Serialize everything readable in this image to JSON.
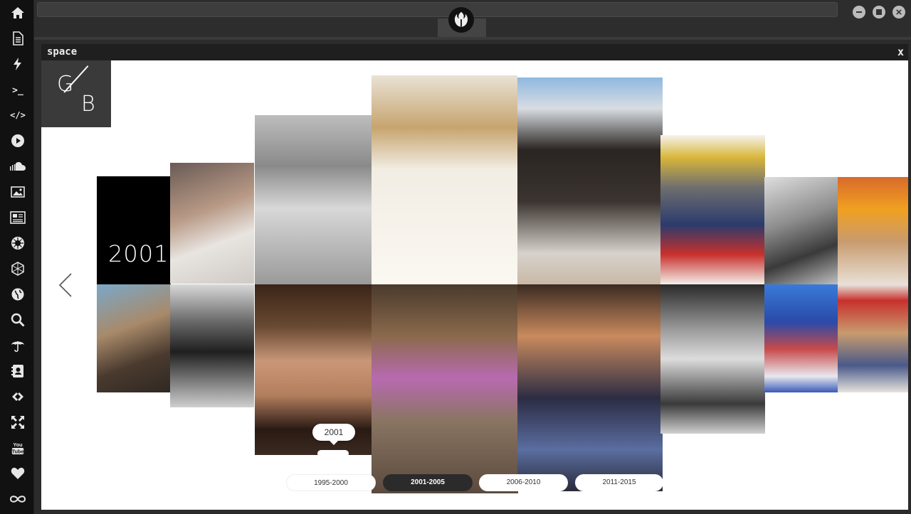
{
  "sidebar": {
    "items": [
      {
        "icon": "home-icon"
      },
      {
        "icon": "document-icon"
      },
      {
        "icon": "lightning-icon"
      },
      {
        "icon": "terminal-icon",
        "glyph": ">_"
      },
      {
        "icon": "code-icon",
        "glyph": "</>"
      },
      {
        "icon": "play-icon"
      },
      {
        "icon": "soundcloud-icon"
      },
      {
        "icon": "image-icon"
      },
      {
        "icon": "news-icon"
      },
      {
        "icon": "rebel-icon"
      },
      {
        "icon": "hexagon-icon"
      },
      {
        "icon": "globe-icon"
      },
      {
        "icon": "search-icon"
      },
      {
        "icon": "umbrella-icon"
      },
      {
        "icon": "contacts-icon"
      },
      {
        "icon": "link-icon"
      },
      {
        "icon": "expand-icon"
      },
      {
        "icon": "youtube-icon",
        "glyph": "You\nTube"
      },
      {
        "icon": "heart-icon"
      },
      {
        "icon": "infinity-icon"
      }
    ]
  },
  "window": {
    "logo_icon": "rebel-alliance-icon"
  },
  "panel": {
    "title": "space",
    "close_label": "x",
    "logo_g": "G",
    "logo_b": "B",
    "year_label": "2001",
    "tooltip_label": "2001",
    "periods": [
      "1995-2000",
      "2001-2005",
      "2006-2010",
      "2011-2015"
    ],
    "active_period": "2001-2005"
  },
  "colors": {
    "sidebar_bg": "#111111",
    "topbar_bg": "#2d2d2d",
    "active_period_bg": "#2b2b2b",
    "logo_bg": "#3a3a3a"
  }
}
